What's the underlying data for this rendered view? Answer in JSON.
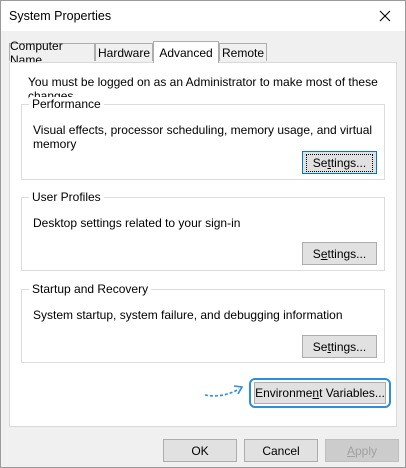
{
  "window": {
    "title": "System Properties",
    "close_glyph": "✕"
  },
  "tabs": [
    {
      "label": "Computer Name"
    },
    {
      "label": "Hardware"
    },
    {
      "label": "Advanced"
    },
    {
      "label": "Remote"
    }
  ],
  "panel": {
    "admin_note": "You must be logged on as an Administrator to make most of these changes.",
    "performance": {
      "title": "Performance",
      "description": "Visual effects, processor scheduling, memory usage, and virtual memory",
      "button_pre": "Se",
      "button_u": "t",
      "button_post": "tings..."
    },
    "user_profiles": {
      "title": "User Profiles",
      "description": "Desktop settings related to your sign-in",
      "button_pre": "S",
      "button_u": "e",
      "button_post": "ttings..."
    },
    "startup": {
      "title": "Startup and Recovery",
      "description": "System startup, system failure, and debugging information",
      "button_pre": "Se",
      "button_u": "t",
      "button_post": "tings..."
    },
    "env_button": {
      "pre": "Environme",
      "u": "n",
      "post": "t Variables..."
    }
  },
  "footer": {
    "ok": "OK",
    "cancel": "Cancel",
    "apply_u": "A",
    "apply_post": "pply"
  },
  "colors": {
    "highlight": "#2a8fdc",
    "focus_border": "#0078d7"
  }
}
